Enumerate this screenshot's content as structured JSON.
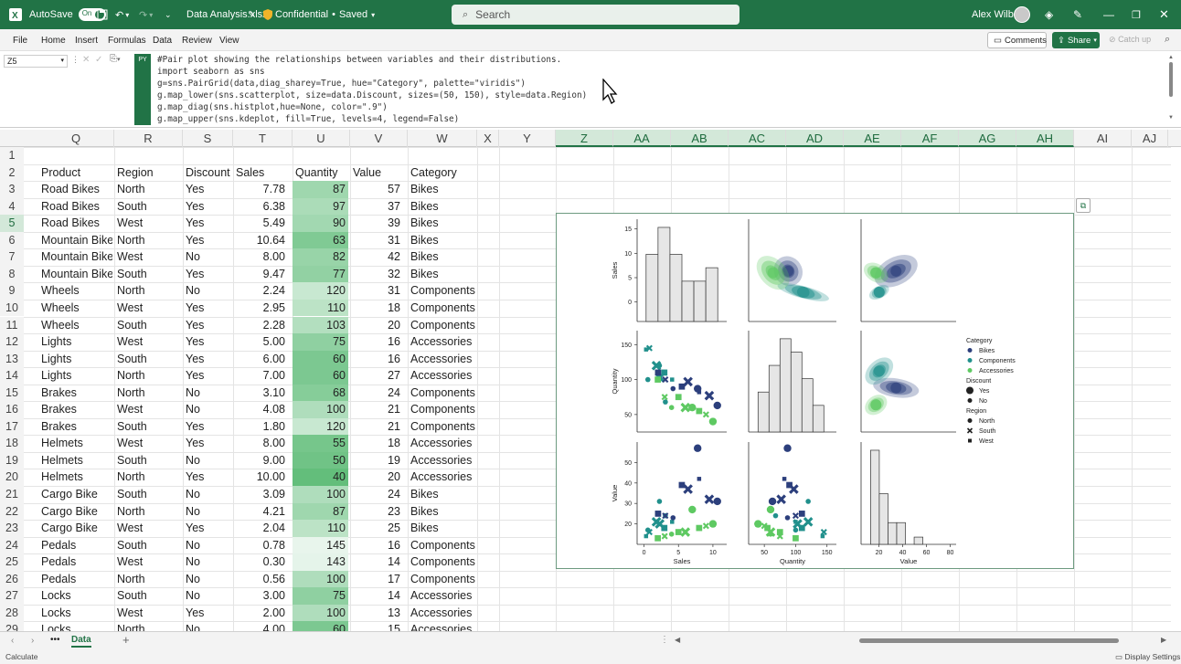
{
  "titlebar": {
    "autosave_label": "AutoSave",
    "autosave_state": "On",
    "filename": "Data Analysis.xlsx",
    "sensitivity": "Confidential",
    "save_status": "Saved",
    "search_placeholder": "Search",
    "user_name": "Alex Wilber"
  },
  "menu": {
    "items": [
      "File",
      "Home",
      "Insert",
      "Formulas",
      "Data",
      "Review",
      "View"
    ],
    "comments_label": "Comments",
    "share_label": "Share",
    "catchup_label": "Catch up"
  },
  "formula_bar": {
    "cell_ref": "Z5",
    "py_badge": "PY",
    "lines": [
      "#Pair plot showing the relationships between variables and their distributions.",
      "import seaborn as sns",
      "g=sns.PairGrid(data,diag_sharey=True, hue=\"Category\", palette=\"viridis\")",
      "g.map_lower(sns.scatterplot, size=data.Discount, sizes=(50, 150), style=data.Region)",
      "g.map_diag(sns.histplot,hue=None, color=\".9\")",
      "g.map_upper(sns.kdeplot, fill=True, levels=4, legend=False)"
    ]
  },
  "columns": [
    "Q",
    "R",
    "S",
    "T",
    "U",
    "V",
    "W",
    "X",
    "Y",
    "Z",
    "AA",
    "AB",
    "AC",
    "AD",
    "AE",
    "AF",
    "AG",
    "AH",
    "AI",
    "AJ"
  ],
  "rows": [
    "1",
    "2",
    "3",
    "4",
    "5",
    "6",
    "7",
    "8",
    "9",
    "10",
    "11",
    "12",
    "13",
    "14",
    "15",
    "16",
    "17",
    "18",
    "19",
    "20",
    "21",
    "22",
    "23",
    "24",
    "25",
    "26",
    "27",
    "28",
    "29"
  ],
  "table": {
    "headers": [
      "Product",
      "Region",
      "Discount",
      "Sales",
      "Quantity",
      "Value",
      "Category"
    ],
    "rows": [
      [
        "Road Bikes",
        "North",
        "Yes",
        "7.78",
        "87",
        "57",
        "Bikes"
      ],
      [
        "Road Bikes",
        "South",
        "Yes",
        "6.38",
        "97",
        "37",
        "Bikes"
      ],
      [
        "Road Bikes",
        "West",
        "Yes",
        "5.49",
        "90",
        "39",
        "Bikes"
      ],
      [
        "Mountain Bikes",
        "North",
        "Yes",
        "10.64",
        "63",
        "31",
        "Bikes"
      ],
      [
        "Mountain Bikes",
        "West",
        "No",
        "8.00",
        "82",
        "42",
        "Bikes"
      ],
      [
        "Mountain Bikes",
        "South",
        "Yes",
        "9.47",
        "77",
        "32",
        "Bikes"
      ],
      [
        "Wheels",
        "North",
        "No",
        "2.24",
        "120",
        "31",
        "Components"
      ],
      [
        "Wheels",
        "West",
        "Yes",
        "2.95",
        "110",
        "18",
        "Components"
      ],
      [
        "Wheels",
        "South",
        "Yes",
        "2.28",
        "103",
        "20",
        "Components"
      ],
      [
        "Lights",
        "West",
        "Yes",
        "5.00",
        "75",
        "16",
        "Accessories"
      ],
      [
        "Lights",
        "South",
        "Yes",
        "6.00",
        "60",
        "16",
        "Accessories"
      ],
      [
        "Lights",
        "North",
        "Yes",
        "7.00",
        "60",
        "27",
        "Accessories"
      ],
      [
        "Brakes",
        "North",
        "No",
        "3.10",
        "68",
        "24",
        "Components"
      ],
      [
        "Brakes",
        "West",
        "No",
        "4.08",
        "100",
        "21",
        "Components"
      ],
      [
        "Brakes",
        "South",
        "Yes",
        "1.80",
        "120",
        "21",
        "Components"
      ],
      [
        "Helmets",
        "West",
        "Yes",
        "8.00",
        "55",
        "18",
        "Accessories"
      ],
      [
        "Helmets",
        "South",
        "No",
        "9.00",
        "50",
        "19",
        "Accessories"
      ],
      [
        "Helmets",
        "North",
        "Yes",
        "10.00",
        "40",
        "20",
        "Accessories"
      ],
      [
        "Cargo Bike",
        "South",
        "No",
        "3.09",
        "100",
        "24",
        "Bikes"
      ],
      [
        "Cargo Bike",
        "North",
        "No",
        "4.21",
        "87",
        "23",
        "Bikes"
      ],
      [
        "Cargo Bike",
        "West",
        "Yes",
        "2.04",
        "110",
        "25",
        "Bikes"
      ],
      [
        "Pedals",
        "South",
        "No",
        "0.78",
        "145",
        "16",
        "Components"
      ],
      [
        "Pedals",
        "West",
        "No",
        "0.30",
        "143",
        "14",
        "Components"
      ],
      [
        "Pedals",
        "North",
        "No",
        "0.56",
        "100",
        "17",
        "Components"
      ],
      [
        "Locks",
        "South",
        "No",
        "3.00",
        "75",
        "14",
        "Accessories"
      ],
      [
        "Locks",
        "West",
        "Yes",
        "2.00",
        "100",
        "13",
        "Accessories"
      ],
      [
        "Locks",
        "North",
        "No",
        "4.00",
        "60",
        "15",
        "Accessories"
      ]
    ]
  },
  "chart_data": {
    "type": "scatter",
    "kind": "pairplot",
    "variables": [
      "Sales",
      "Quantity",
      "Value"
    ],
    "ylabels": [
      "Sales",
      "Quantity",
      "Value"
    ],
    "xlabels": [
      "Sales",
      "Quantity",
      "Value"
    ],
    "ticks": {
      "Sales_y": [
        0,
        5,
        10,
        15
      ],
      "Quantity_y": [
        50,
        100,
        150
      ],
      "Value_y": [
        20,
        30,
        40,
        50
      ],
      "Sales_x": [
        0,
        5,
        10
      ],
      "Quantity_x": [
        50,
        100,
        150
      ],
      "Value_x": [
        20,
        40,
        60,
        80
      ]
    },
    "hue": "Category",
    "palette": {
      "Bikes": "#2c3f7c",
      "Components": "#21908c",
      "Accessories": "#5ec962"
    },
    "legend": {
      "placement": "right",
      "Category": [
        "Bikes",
        "Components",
        "Accessories"
      ],
      "Discount": [
        "Yes",
        "No"
      ],
      "Region": [
        "North",
        "South",
        "West"
      ]
    },
    "points": [
      {
        "Sales": 7.78,
        "Quantity": 87,
        "Value": 57,
        "Category": "Bikes",
        "Discount": "Yes",
        "Region": "North"
      },
      {
        "Sales": 6.38,
        "Quantity": 97,
        "Value": 37,
        "Category": "Bikes",
        "Discount": "Yes",
        "Region": "South"
      },
      {
        "Sales": 5.49,
        "Quantity": 90,
        "Value": 39,
        "Category": "Bikes",
        "Discount": "Yes",
        "Region": "West"
      },
      {
        "Sales": 10.64,
        "Quantity": 63,
        "Value": 31,
        "Category": "Bikes",
        "Discount": "Yes",
        "Region": "North"
      },
      {
        "Sales": 8.0,
        "Quantity": 82,
        "Value": 42,
        "Category": "Bikes",
        "Discount": "No",
        "Region": "West"
      },
      {
        "Sales": 9.47,
        "Quantity": 77,
        "Value": 32,
        "Category": "Bikes",
        "Discount": "Yes",
        "Region": "South"
      },
      {
        "Sales": 2.24,
        "Quantity": 120,
        "Value": 31,
        "Category": "Components",
        "Discount": "No",
        "Region": "North"
      },
      {
        "Sales": 2.95,
        "Quantity": 110,
        "Value": 18,
        "Category": "Components",
        "Discount": "Yes",
        "Region": "West"
      },
      {
        "Sales": 2.28,
        "Quantity": 103,
        "Value": 20,
        "Category": "Components",
        "Discount": "Yes",
        "Region": "South"
      },
      {
        "Sales": 5.0,
        "Quantity": 75,
        "Value": 16,
        "Category": "Accessories",
        "Discount": "Yes",
        "Region": "West"
      },
      {
        "Sales": 6.0,
        "Quantity": 60,
        "Value": 16,
        "Category": "Accessories",
        "Discount": "Yes",
        "Region": "South"
      },
      {
        "Sales": 7.0,
        "Quantity": 60,
        "Value": 27,
        "Category": "Accessories",
        "Discount": "Yes",
        "Region": "North"
      },
      {
        "Sales": 3.1,
        "Quantity": 68,
        "Value": 24,
        "Category": "Components",
        "Discount": "No",
        "Region": "North"
      },
      {
        "Sales": 4.08,
        "Quantity": 100,
        "Value": 21,
        "Category": "Components",
        "Discount": "No",
        "Region": "West"
      },
      {
        "Sales": 1.8,
        "Quantity": 120,
        "Value": 21,
        "Category": "Components",
        "Discount": "Yes",
        "Region": "South"
      },
      {
        "Sales": 8.0,
        "Quantity": 55,
        "Value": 18,
        "Category": "Accessories",
        "Discount": "Yes",
        "Region": "West"
      },
      {
        "Sales": 9.0,
        "Quantity": 50,
        "Value": 19,
        "Category": "Accessories",
        "Discount": "No",
        "Region": "South"
      },
      {
        "Sales": 10.0,
        "Quantity": 40,
        "Value": 20,
        "Category": "Accessories",
        "Discount": "Yes",
        "Region": "North"
      },
      {
        "Sales": 3.09,
        "Quantity": 100,
        "Value": 24,
        "Category": "Bikes",
        "Discount": "No",
        "Region": "South"
      },
      {
        "Sales": 4.21,
        "Quantity": 87,
        "Value": 23,
        "Category": "Bikes",
        "Discount": "No",
        "Region": "North"
      },
      {
        "Sales": 2.04,
        "Quantity": 110,
        "Value": 25,
        "Category": "Bikes",
        "Discount": "Yes",
        "Region": "West"
      },
      {
        "Sales": 0.78,
        "Quantity": 145,
        "Value": 16,
        "Category": "Components",
        "Discount": "No",
        "Region": "South"
      },
      {
        "Sales": 0.3,
        "Quantity": 143,
        "Value": 14,
        "Category": "Components",
        "Discount": "No",
        "Region": "West"
      },
      {
        "Sales": 0.56,
        "Quantity": 100,
        "Value": 17,
        "Category": "Components",
        "Discount": "No",
        "Region": "North"
      },
      {
        "Sales": 3.0,
        "Quantity": 75,
        "Value": 14,
        "Category": "Accessories",
        "Discount": "No",
        "Region": "South"
      },
      {
        "Sales": 2.0,
        "Quantity": 100,
        "Value": 13,
        "Category": "Accessories",
        "Discount": "Yes",
        "Region": "West"
      },
      {
        "Sales": 4.0,
        "Quantity": 60,
        "Value": 15,
        "Category": "Accessories",
        "Discount": "No",
        "Region": "North"
      }
    ]
  },
  "sheetbar": {
    "active_sheet": "Data"
  },
  "statusbar": {
    "left": "Calculate",
    "right": "Display Settings"
  }
}
